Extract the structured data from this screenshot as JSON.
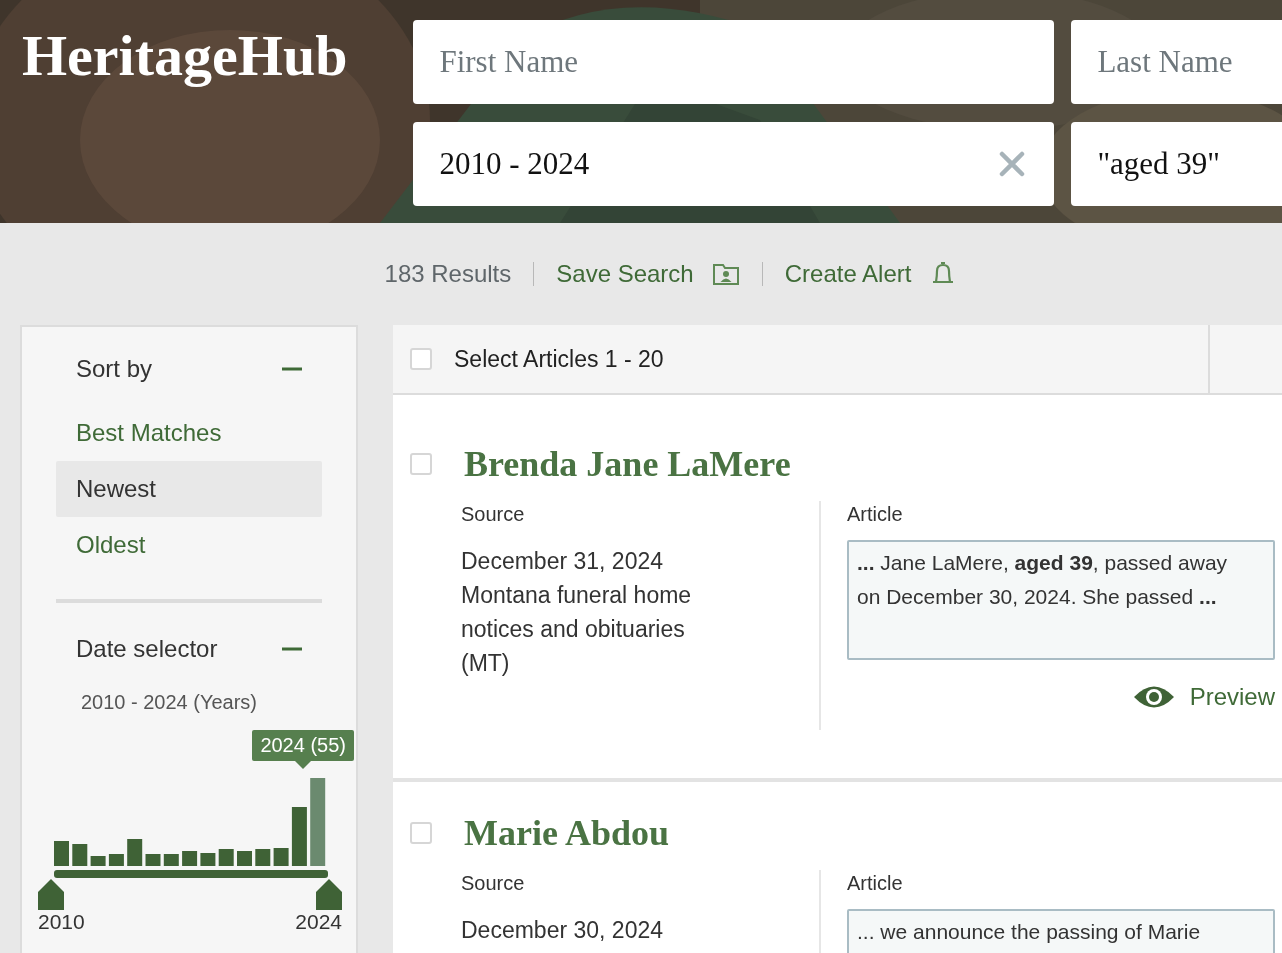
{
  "header": {
    "logo": "HeritageHub",
    "fields": [
      {
        "placeholder": "First Name"
      },
      {
        "placeholder": "Last Name"
      },
      {
        "value": "2010 - 2024",
        "clearable": true
      },
      {
        "value": "\"aged 39\"",
        "clearable": false
      }
    ]
  },
  "toolbar": {
    "results": "183 Results",
    "links": [
      {
        "label": "Save Search"
      },
      {
        "label": "Create Alert"
      }
    ]
  },
  "sidebar": {
    "sort": {
      "title": "Sort by",
      "expanded": true,
      "options": [
        {
          "label": "Best Matches",
          "selected": false
        },
        {
          "label": "Newest",
          "selected": true
        },
        {
          "label": "Oldest",
          "selected": false
        }
      ]
    },
    "date_selector": {
      "title": "Date selector",
      "expanded": true,
      "range_label": "2010 - 2024 (Years)",
      "tooltip": "2024 (55)",
      "start_label": "2010",
      "end_label": "2024"
    }
  },
  "results": {
    "select_all": {
      "label": "Select Articles 1 - 20",
      "checked": false
    },
    "items": [
      {
        "name": "Brenda Jane LaMere",
        "checked": false,
        "source_label": "Source",
        "date": "December 31, 2024",
        "publication": "Montana funeral home notices and obituaries (MT)",
        "article_label": "Article",
        "snippet": "**...** Jane LaMere, **aged 39**, passed away on December 30, 2024. She passed **...**",
        "preview": "Preview"
      },
      {
        "name": "Marie Abdou",
        "checked": false,
        "source_label": "Source",
        "date": "December 30, 2024",
        "article_label": "Article",
        "snippet": "... we announce the passing of Marie"
      }
    ]
  }
}
